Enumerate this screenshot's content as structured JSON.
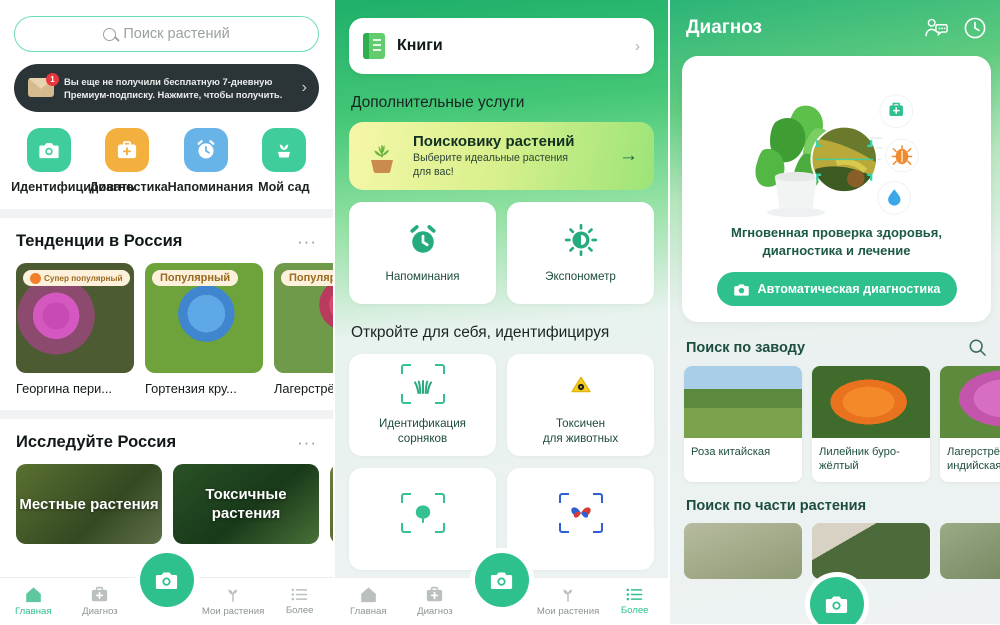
{
  "panel1": {
    "search": {
      "placeholder": "Поиск растений",
      "icon": "search-icon"
    },
    "promo": {
      "line1": "Вы еще не получили бесплатную 7-дневную",
      "line2": "Премиум-подписку. Нажмите, чтобы получить.",
      "badge_count": "1",
      "chevron": "›"
    },
    "quick_actions": [
      {
        "label": "Идентифицировать",
        "icon": "camera-icon",
        "color": "#3fcd9b"
      },
      {
        "label": "Диагностика",
        "icon": "medical-kit-icon",
        "color": "#f4b03e"
      },
      {
        "label": "Напоминания",
        "icon": "alarm-clock-icon",
        "color": "#68b4e8"
      },
      {
        "label": "Мой сад",
        "icon": "plant-pot-icon",
        "color": "#3fcd9b"
      }
    ],
    "trending": {
      "title": "Тенденции в Россия",
      "more": "···",
      "items": [
        {
          "badge": "Супер популярный",
          "badge_type": "super",
          "name": "Георгина пери..."
        },
        {
          "badge": "Популярный",
          "badge_type": "pop",
          "name": "Гортензия кру..."
        },
        {
          "badge": "Популярн",
          "badge_type": "pop",
          "name": "Лагерстрё"
        }
      ]
    },
    "explore": {
      "title": "Исследуйте Россия",
      "more": "···",
      "items": [
        {
          "label": "Местные растения"
        },
        {
          "label": "Токсичные растения"
        },
        {
          "label": ""
        }
      ]
    },
    "navbar": {
      "items": [
        {
          "label": "Главная",
          "icon": "home-icon",
          "active": true
        },
        {
          "label": "Диагноз",
          "icon": "medical-kit-icon",
          "active": false
        },
        {
          "label": "Мои растения",
          "icon": "sprout-icon",
          "active": false
        },
        {
          "label": "Более",
          "icon": "list-icon",
          "active": false
        }
      ],
      "fab": "camera-icon"
    }
  },
  "panel2": {
    "books_card": {
      "label": "Книги",
      "icon": "book-icon",
      "chevron": "›"
    },
    "services_heading": "Дополнительные услуги",
    "finder_card": {
      "title": "Поисковику растений",
      "subtitle_line1": "Выберите идеальные растения",
      "subtitle_line2": "для вас!",
      "icon": "potted-plant-icon",
      "arrow": "→"
    },
    "tools": [
      {
        "label": "Напоминания",
        "icon": "alarm-clock-icon"
      },
      {
        "label": "Экспонометр",
        "icon": "light-meter-icon"
      }
    ],
    "discover_heading": "Откройте для себя, идентифицируя",
    "discover": [
      {
        "label_line1": "Идентификация",
        "label_line2": "сорняков",
        "icon": "scan-weed-icon"
      },
      {
        "label_line1": "Токсичен",
        "label_line2": "для животных",
        "icon": "scan-toxic-icon"
      },
      {
        "label_line1": "",
        "label_line2": "",
        "icon": "scan-tree-icon"
      },
      {
        "label_line1": "",
        "label_line2": "",
        "icon": "scan-butterfly-icon"
      }
    ],
    "navbar": {
      "items": [
        {
          "label": "Главная",
          "icon": "home-icon",
          "active": false
        },
        {
          "label": "Диагноз",
          "icon": "medical-kit-icon",
          "active": false
        },
        {
          "label": "Мои растения",
          "icon": "sprout-icon",
          "active": false
        },
        {
          "label": "Более",
          "icon": "list-icon",
          "active": true
        }
      ],
      "fab": "camera-icon"
    }
  },
  "panel3": {
    "title": "Диагноз",
    "header_icons": [
      {
        "name": "expert-chat-icon"
      },
      {
        "name": "history-clock-icon"
      }
    ],
    "hero": {
      "caption_line1": "Мгновенная проверка здоровья,",
      "caption_line2": "диагностика и лечение",
      "button_label": "Автоматическая диагностика",
      "button_icon": "camera-icon",
      "float_icons": [
        {
          "name": "medical-kit-icon",
          "color": "#2ec18e"
        },
        {
          "name": "bug-icon",
          "color": "#f08a2e"
        },
        {
          "name": "water-drop-icon",
          "color": "#3aa8e8"
        }
      ]
    },
    "search_plant": {
      "title": "Поиск по заводу",
      "search_icon": "search-icon",
      "items": [
        {
          "name": "Роза китайская"
        },
        {
          "name": "Лилейник буро-жёлтый"
        },
        {
          "name": "Лагерстрё индийская"
        }
      ]
    },
    "search_part": {
      "title": "Поиск по части растения",
      "items": [
        {
          "name": ""
        },
        {
          "name": ""
        },
        {
          "name": ""
        }
      ]
    },
    "navbar": {
      "fab": "camera-icon"
    }
  },
  "colors": {
    "accent": "#2ec18e",
    "green_dark": "#1c4d3e",
    "promo_bg": "#2b3437",
    "badge_bg": "#fdf1dc"
  }
}
